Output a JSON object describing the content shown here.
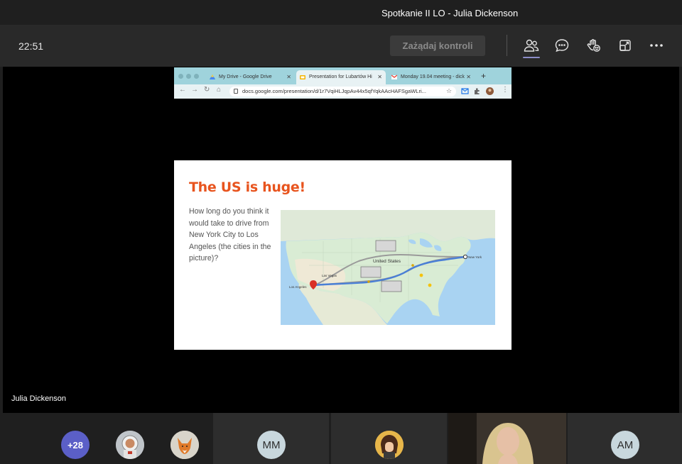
{
  "window": {
    "title": "Spotkanie II LO - Julia Dickenson"
  },
  "toolbar": {
    "time": "22:51",
    "request_control_label": "Zażądaj kontroli",
    "icons": [
      "people-icon",
      "chat-icon",
      "raise-hand-icon",
      "rooms-icon",
      "more-icon"
    ]
  },
  "shared_screen": {
    "tabs": [
      {
        "label": "My Drive - Google Drive",
        "icon": "google-drive-icon"
      },
      {
        "label": "Presentation for Lubartów Hi",
        "icon": "google-slides-icon",
        "active": true
      },
      {
        "label": "Monday 19.04 meeting - dick",
        "icon": "gmail-icon"
      }
    ],
    "url": "docs.google.com/presentation/d/1r7VqiHLJqpAv44x5qfYqkAAcHAFSgaWLri...",
    "slide": {
      "title": "The US is huge!",
      "question": "How long do you think it would take to drive from New York City to Los Angeles (the cities in the picture)?",
      "map": {
        "labels": {
          "us": "United States",
          "ny": "New York",
          "la": "Los Angeles",
          "lv": "Las Vegas"
        },
        "colors": {
          "water": "#a9d3f2",
          "land": "#d9ecd4",
          "route": "#4a7fd6",
          "route_alt": "#9a9a9a"
        }
      }
    }
  },
  "presenter_name": "Julia Dickenson",
  "participants": {
    "overflow_count": "+28",
    "initials": [
      "MM",
      "AM"
    ]
  },
  "colors": {
    "accent": "#5b5fc7",
    "slide_title": "#e8541e"
  }
}
